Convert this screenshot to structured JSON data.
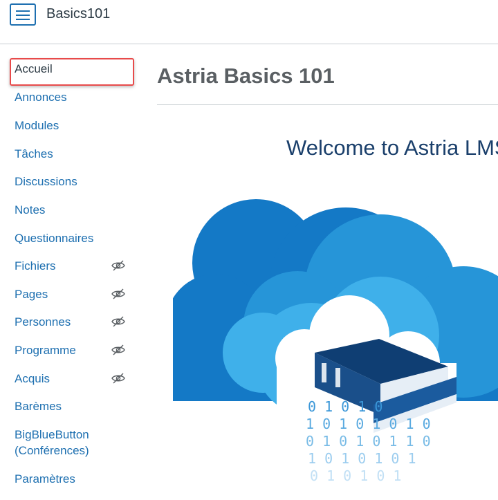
{
  "header": {
    "course_code": "Basics101"
  },
  "nav": {
    "items": [
      {
        "label": "Accueil",
        "active": true,
        "hidden": false
      },
      {
        "label": "Annonces",
        "hidden": false
      },
      {
        "label": "Modules",
        "hidden": false
      },
      {
        "label": "Tâches",
        "hidden": false
      },
      {
        "label": "Discussions",
        "hidden": false
      },
      {
        "label": "Notes",
        "hidden": false
      },
      {
        "label": "Questionnaires",
        "hidden": false
      },
      {
        "label": "Fichiers",
        "hidden": true
      },
      {
        "label": "Pages",
        "hidden": true
      },
      {
        "label": "Personnes",
        "hidden": true
      },
      {
        "label": "Programme",
        "hidden": true
      },
      {
        "label": "Acquis",
        "hidden": true
      },
      {
        "label": "Barèmes",
        "hidden": false
      },
      {
        "label": "BigBlueButton",
        "label_line2": "(Conférences)",
        "hidden": false
      },
      {
        "label": "Paramètres",
        "hidden": false
      }
    ]
  },
  "main": {
    "title": "Astria Basics 101",
    "welcome": "Welcome to Astria LMS"
  },
  "colors": {
    "link": "#1d6fb0",
    "highlight_border": "#e84a4a",
    "title": "#5a5f63",
    "welcome": "#1a3f6b"
  },
  "icons": {
    "menu": "hamburger-menu-icon",
    "hidden": "eye-slash-icon",
    "hero": "cloud-books-binary-illustration"
  }
}
